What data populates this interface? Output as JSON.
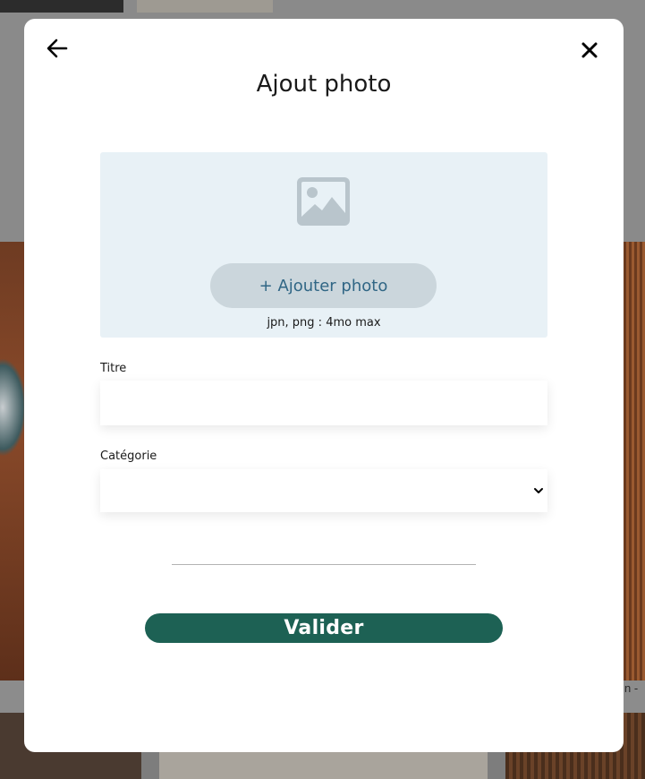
{
  "background": {
    "caption_fragment": "n -"
  },
  "modal": {
    "title": "Ajout photo",
    "back_icon": "arrow-left-icon",
    "close_icon": "close-icon",
    "upload": {
      "image_icon": "image-placeholder-icon",
      "add_button_label": "+ Ajouter photo",
      "hint": "jpn, png : 4mo max"
    },
    "fields": {
      "title_label": "Titre",
      "title_value": "",
      "category_label": "Catégorie",
      "category_value": ""
    },
    "submit_label": "Valider"
  },
  "colors": {
    "accent": "#1d6154",
    "upload_bg": "#e8f1f6",
    "add_button_bg": "#cbd6dc",
    "add_button_text": "#306685",
    "overlay": "#7d7d7d"
  }
}
